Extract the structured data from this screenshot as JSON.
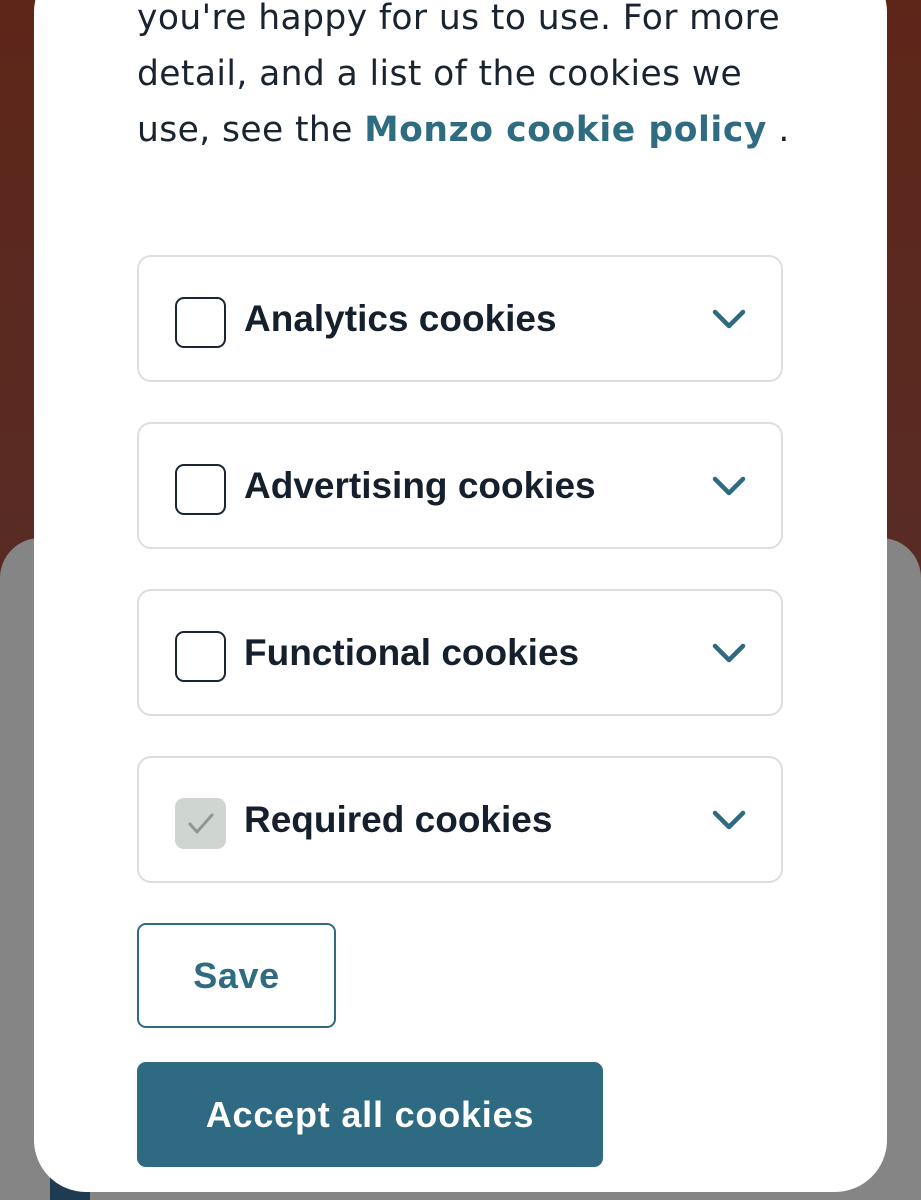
{
  "intro": {
    "text_before_link": "you're happy for us to use. For more detail, and a list of the cookies we use, see the ",
    "link_label": "Monzo cookie policy",
    "text_after_link": " ."
  },
  "cookies": [
    {
      "label": "Analytics cookies",
      "checked": false,
      "disabled": false,
      "icon": "chevron-down-icon"
    },
    {
      "label": "Advertising cookies",
      "checked": false,
      "disabled": false,
      "icon": "chevron-down-icon"
    },
    {
      "label": "Functional cookies",
      "checked": false,
      "disabled": false,
      "icon": "chevron-down-icon"
    },
    {
      "label": "Required cookies",
      "checked": true,
      "disabled": true,
      "icon": "chevron-down-icon"
    }
  ],
  "actions": {
    "save_label": "Save",
    "accept_all_label": "Accept all cookies"
  },
  "colors": {
    "accent": "#2e6b82",
    "text": "#16202c",
    "border": "#dcdfe2",
    "disabled_check_bg": "#cfd6d2"
  }
}
